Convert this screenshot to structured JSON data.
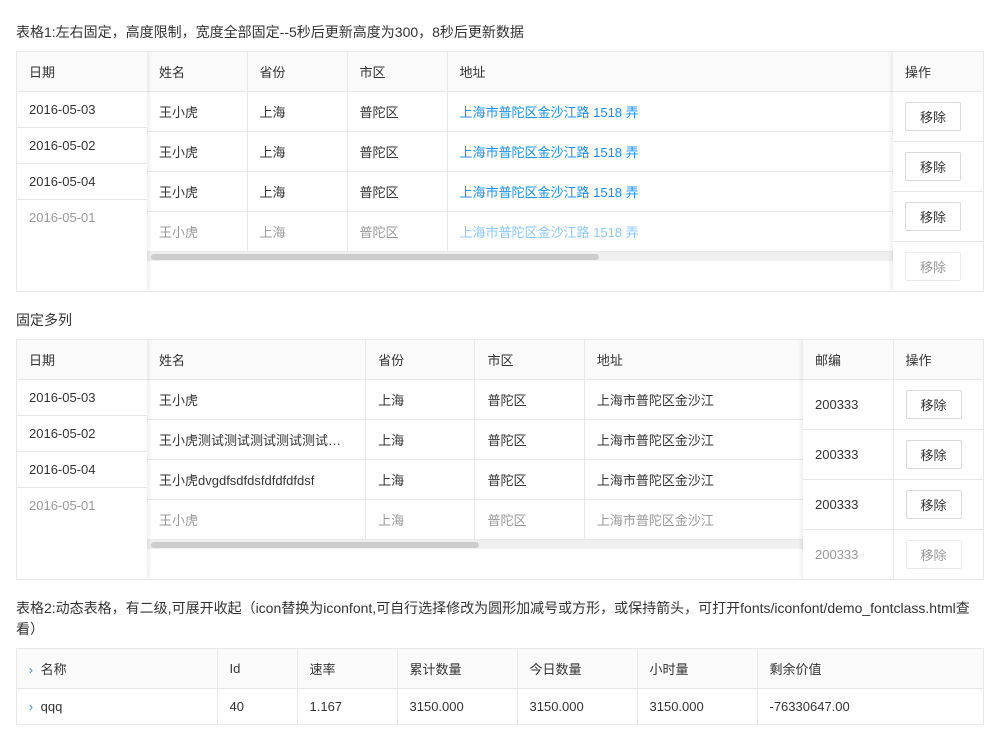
{
  "table1": {
    "title": "表格1:左右固定，高度限制，宽度全部固定--5秒后更新高度为300，8秒后更新数据",
    "columns": {
      "date": "日期",
      "name": "姓名",
      "province": "省份",
      "city": "市区",
      "address": "地址",
      "action": "操作"
    },
    "rows": [
      {
        "date": "2016-05-03",
        "name": "王小虎",
        "province": "上海",
        "city": "普陀区",
        "address": "上海市普陀区金沙江路 1518 弄"
      },
      {
        "date": "2016-05-02",
        "name": "王小虎",
        "province": "上海",
        "city": "普陀区",
        "address": "上海市普陀区金沙江路 1518 弄"
      },
      {
        "date": "2016-05-04",
        "name": "王小虎",
        "province": "上海",
        "city": "普陀区",
        "address": "上海市普陀区金沙江路 1518 弄"
      },
      {
        "date": "2016-05-01",
        "name": "王小虎",
        "province": "上海",
        "city": "普陀区",
        "address": "上海市普陀区金沙江路 1518 弄"
      }
    ],
    "remove_label": "移除"
  },
  "table2_title": "固定多列",
  "table2": {
    "columns": {
      "date": "日期",
      "name": "姓名",
      "province": "省份",
      "city": "市区",
      "address": "地址",
      "zip": "邮编",
      "action": "操作"
    },
    "rows": [
      {
        "date": "2016-05-03",
        "name": "王小虎",
        "province": "上海",
        "city": "普陀区",
        "address": "上海市普陀区金沙江",
        "zip": "200333"
      },
      {
        "date": "2016-05-02",
        "name": "王小虎测试测试测试测试测试宽度",
        "province": "上海",
        "city": "普陀区",
        "address": "上海市普陀区金沙江",
        "zip": "200333"
      },
      {
        "date": "2016-05-04",
        "name": "王小虎dvgdfsdfdsfdfdfdfdsf",
        "province": "上海",
        "city": "普陀区",
        "address": "上海市普陀区金沙江",
        "zip": "200333"
      },
      {
        "date": "2016-05-01",
        "name": "王小虎",
        "province": "上海",
        "city": "普陀区",
        "address": "上海市普陀区金沙江",
        "zip": "200333"
      }
    ],
    "remove_label": "移除"
  },
  "table3": {
    "title": "表格2:动态表格，有二级,可展开收起（icon替换为iconfont,可自行选择修改为圆形加减号或方形，或保持箭头，可打开fonts/iconfont/demo_fontclass.html查看）",
    "columns": {
      "name": "名称",
      "id": "Id",
      "speed": "速率",
      "total": "累计数量",
      "today": "今日数量",
      "hours": "小时量",
      "remaining": "剩余价值"
    },
    "rows": [
      {
        "name": "qqq",
        "id": "40",
        "speed": "1.167",
        "total": "3150.000",
        "today": "3150.000",
        "hours": "3150.000",
        "remaining": "-76330647.00"
      }
    ]
  }
}
